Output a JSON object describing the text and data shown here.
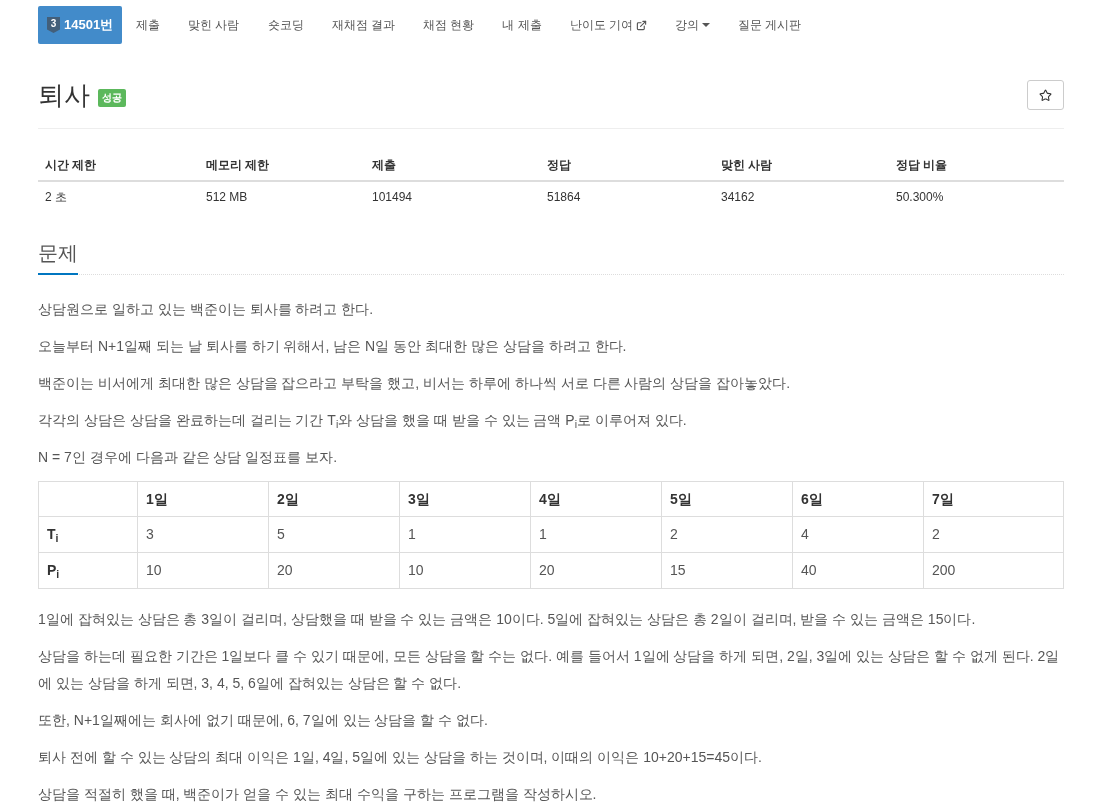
{
  "nav": {
    "items": [
      {
        "kind": "problem",
        "tier": "3",
        "label": "14501번",
        "selected": true
      },
      {
        "kind": "link",
        "label": "제출",
        "selected": false
      },
      {
        "kind": "link",
        "label": "맞힌 사람",
        "selected": false
      },
      {
        "kind": "link",
        "label": "숏코딩",
        "selected": false
      },
      {
        "kind": "link",
        "label": "재채점 결과",
        "selected": false
      },
      {
        "kind": "link",
        "label": "채점 현황",
        "selected": false
      },
      {
        "kind": "link",
        "label": "내 제출",
        "selected": false
      },
      {
        "kind": "external",
        "label": "난이도 기여",
        "selected": false
      },
      {
        "kind": "dropdown",
        "label": "강의",
        "selected": false
      },
      {
        "kind": "link",
        "label": "질문 게시판",
        "selected": false
      }
    ]
  },
  "problem": {
    "title": "퇴사",
    "result_badge": "성공"
  },
  "info_table": {
    "columns": [
      "시간 제한",
      "메모리 제한",
      "제출",
      "정답",
      "맞힌 사람",
      "정답 비율"
    ],
    "row": [
      "2 초",
      "512 MB",
      "101494",
      "51864",
      "34162",
      "50.300%"
    ]
  },
  "section": {
    "title": "문제"
  },
  "description_before": [
    "상담원으로 일하고 있는 백준이는 퇴사를 하려고 한다.",
    "오늘부터 N+1일째 되는 날 퇴사를 하기 위해서, 남은 N일 동안 최대한 많은 상담을 하려고 한다.",
    "백준이는 비서에게 최대한 많은 상담을 잡으라고 부탁을 했고, 비서는 하루에 하나씩 서로 다른 사람의 상담을 잡아놓았다.",
    "각각의 상담은 상담을 완료하는데 걸리는 기간 T$_{i}$와 상담을 했을 때 받을 수 있는 금액 P$_{i}$로 이루어져 있다.",
    "N = 7인 경우에 다음과 같은 상담 일정표를 보자."
  ],
  "schedule_table": {
    "columns": [
      "1일",
      "2일",
      "3일",
      "4일",
      "5일",
      "6일",
      "7일"
    ],
    "rows": [
      {
        "label": "T$_{i}$",
        "cells": [
          "3",
          "5",
          "1",
          "1",
          "2",
          "4",
          "2"
        ]
      },
      {
        "label": "P$_{i}$",
        "cells": [
          "10",
          "20",
          "10",
          "20",
          "15",
          "40",
          "200"
        ]
      }
    ]
  },
  "description_after": [
    "1일에 잡혀있는 상담은 총 3일이 걸리며, 상담했을 때 받을 수 있는 금액은 10이다. 5일에 잡혀있는 상담은 총 2일이 걸리며, 받을 수 있는 금액은 15이다.",
    "상담을 하는데 필요한 기간은 1일보다 클 수 있기 때문에, 모든 상담을 할 수는 없다. 예를 들어서 1일에 상담을 하게 되면, 2일, 3일에 있는 상담은 할 수 없게 된다. 2일에 있는 상담을 하게 되면, 3, 4, 5, 6일에 잡혀있는 상담은 할 수 없다.",
    "또한, N+1일째에는 회사에 없기 때문에, 6, 7일에 있는 상담을 할 수 없다.",
    "퇴사 전에 할 수 있는 상담의 최대 이익은 1일, 4일, 5일에 있는 상담을 하는 것이며, 이때의 이익은 10+20+15=45이다.",
    "상담을 적절히 했을 때, 백준이가 얻을 수 있는 최대 수익을 구하는 프로그램을 작성하시오."
  ]
}
